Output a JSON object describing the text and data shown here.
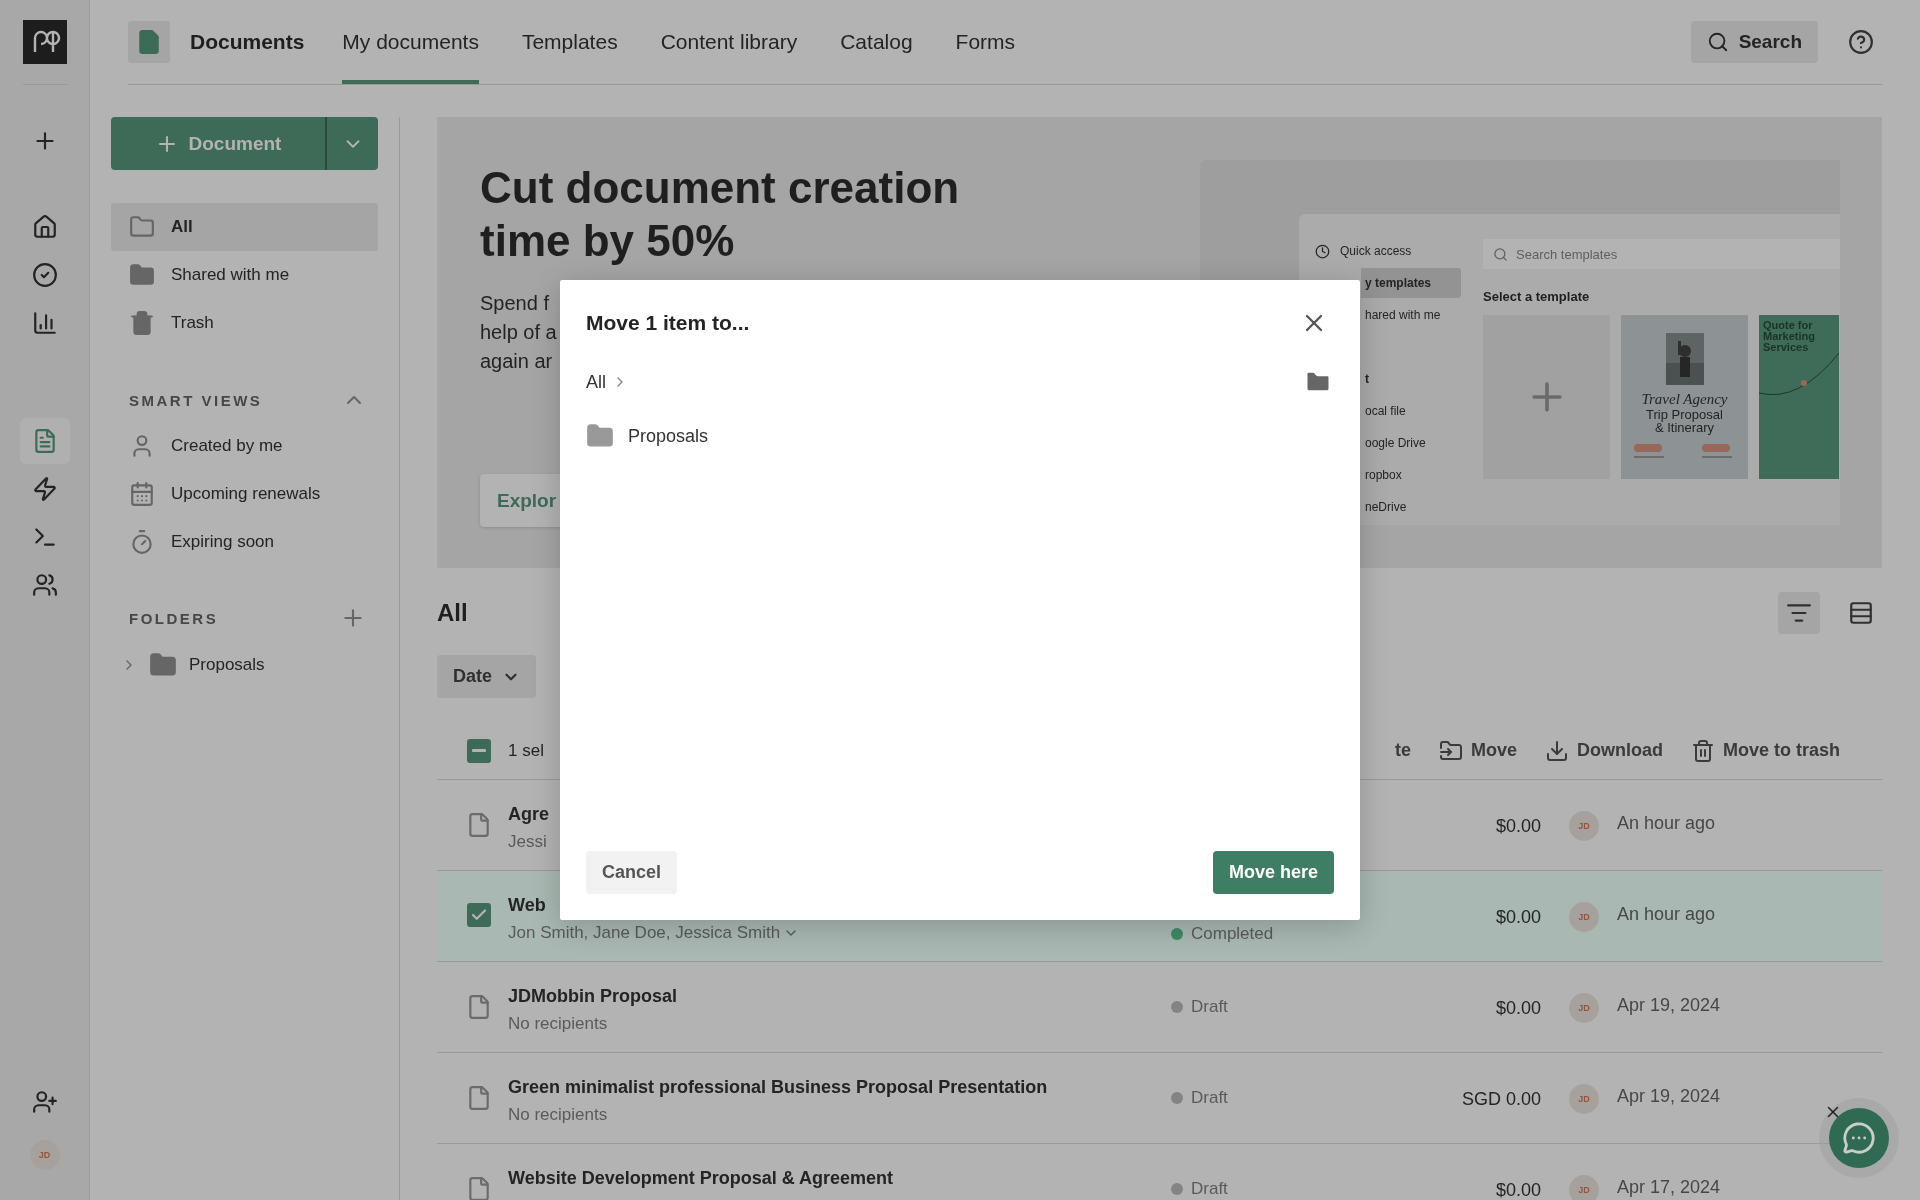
{
  "rail": {
    "items": [
      {
        "selected": false
      },
      {
        "selected": false
      },
      {
        "selected": false
      },
      {
        "selected": false
      },
      {
        "selected": true
      },
      {
        "selected": false
      },
      {
        "selected": false
      },
      {
        "selected": false
      },
      {
        "selected": false
      }
    ],
    "avatar": "JD"
  },
  "nav": {
    "section": "Documents",
    "tabs": [
      {
        "label": "My documents",
        "selected": true
      },
      {
        "label": "Templates",
        "selected": false
      },
      {
        "label": "Content library",
        "selected": false
      },
      {
        "label": "Catalog",
        "selected": false
      },
      {
        "label": "Forms",
        "selected": false
      }
    ],
    "search": "Search"
  },
  "sidebar": {
    "new_button": "Document",
    "views": [
      {
        "label": "All",
        "selected": true
      },
      {
        "label": "Shared with me",
        "selected": false
      },
      {
        "label": "Trash",
        "selected": false
      }
    ],
    "smart_views": {
      "heading": "SMART VIEWS",
      "expanded": true,
      "items": [
        "Created by me",
        "Upcoming renewals",
        "Expiring soon"
      ]
    },
    "folders": {
      "heading": "FOLDERS",
      "items": [
        {
          "label": "Proposals",
          "expanded": false
        }
      ]
    }
  },
  "banner": {
    "title": "Cut document creation time by 50%",
    "text_lines": [
      "Spend f",
      "help of a",
      "again ar"
    ],
    "button": "Explor",
    "preview": {
      "nav": [
        {
          "label": "Quick access",
          "kind": "shortcut",
          "selected": false
        },
        {
          "label": "y templates",
          "kind": "item",
          "selected": true
        },
        {
          "label": "hared with me",
          "kind": "item",
          "selected": false
        },
        {
          "label": "t",
          "kind": "section",
          "selected": false
        },
        {
          "label": "ocal file",
          "kind": "item",
          "selected": false
        },
        {
          "label": "oogle Drive",
          "kind": "item",
          "selected": false
        },
        {
          "label": "ropbox",
          "kind": "item",
          "selected": false
        },
        {
          "label": "neDrive",
          "kind": "item",
          "selected": false
        }
      ],
      "search_placeholder": "Search templates",
      "heading": "Select a template",
      "templates": [
        {
          "kind": "blank"
        },
        {
          "kind": "travel",
          "script": "Travel Agency",
          "lines": [
            "Trip Proposal",
            "& Itinerary"
          ]
        },
        {
          "kind": "quote",
          "title": "Quote for Marketing Services"
        }
      ]
    }
  },
  "list": {
    "heading": "All",
    "sort": "Date",
    "bulk": {
      "indeterminate": true,
      "count": "1 sel",
      "actions": [
        {
          "kind": "duplicate",
          "label": "te"
        },
        {
          "kind": "move",
          "label": "Move"
        },
        {
          "kind": "download",
          "label": "Download"
        },
        {
          "kind": "trash",
          "label": "Move to trash"
        }
      ]
    },
    "rows": [
      {
        "title": "Agre",
        "recipients": "Jessi",
        "selected": false,
        "amount": "$0.00",
        "avatar": "JD",
        "date": "An hour ago"
      },
      {
        "title": "Web",
        "recipients": "Jon Smith, Jane Doe, Jessica Smith",
        "selected": true,
        "status": {
          "label": "Completed",
          "color": "#3f8a66"
        },
        "amount": "$0.00",
        "avatar": "JD",
        "date": "An hour ago"
      },
      {
        "title": "JDMobbin Proposal",
        "recipients": "No recipients",
        "selected": false,
        "status": {
          "label": "Draft",
          "color": "#848484"
        },
        "amount": "$0.00",
        "avatar": "JD",
        "date": "Apr 19, 2024"
      },
      {
        "title": "Green minimalist professional Business Proposal Presentation",
        "recipients": "No recipients",
        "selected": false,
        "status": {
          "label": "Draft",
          "color": "#848484"
        },
        "amount": "SGD 0.00",
        "avatar": "JD",
        "date": "Apr 19, 2024"
      },
      {
        "title": "Website Development Proposal & Agreement",
        "selected": false,
        "status": {
          "label": "Draft",
          "color": "#848484"
        },
        "amount": "$0.00",
        "avatar": "JD",
        "date": "Apr 17, 2024"
      }
    ]
  },
  "modal": {
    "title": "Move 1 item to...",
    "breadcrumb": "All",
    "folders": [
      "Proposals"
    ],
    "cancel": "Cancel",
    "confirm": "Move here"
  }
}
